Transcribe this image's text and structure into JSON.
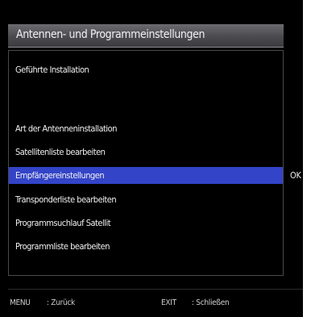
{
  "title": "Antennen- und Programmeinstellungen",
  "menu": {
    "items": [
      {
        "label": "Geführte Installation",
        "selected": false
      },
      {
        "label": "Art der Antenneninstallation",
        "selected": false
      },
      {
        "label": "Satellitenliste bearbeiten",
        "selected": false
      },
      {
        "label": "Empfängereinstellungen",
        "selected": true
      },
      {
        "label": "Transponderliste bearbeiten",
        "selected": false
      },
      {
        "label": "Programmsuchlauf Satellit",
        "selected": false
      },
      {
        "label": "Programmliste bearbeiten",
        "selected": false
      }
    ],
    "ok_hint": "OK"
  },
  "footer": {
    "menu_key": "MENU",
    "menu_action": ": Zurück",
    "exit_key": "EXIT",
    "exit_action": ": Schließen"
  },
  "colors": {
    "background": "#000000",
    "title_bar": "#4a4a4f",
    "selection": "#3344c8",
    "text": "#f0f0f0"
  }
}
